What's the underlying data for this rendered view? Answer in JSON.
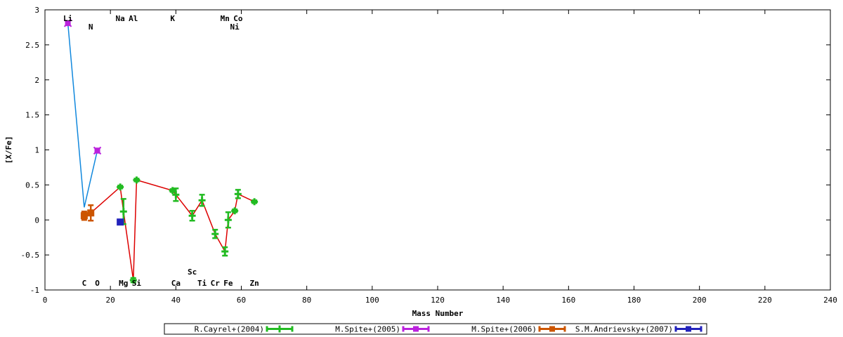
{
  "chart_data": {
    "type": "scatter",
    "xlabel": "Mass Number",
    "ylabel": "[X/Fe]",
    "xlim": [
      0,
      240
    ],
    "ylim": [
      -1,
      3
    ],
    "xticks": [
      0,
      20,
      40,
      60,
      80,
      100,
      120,
      140,
      160,
      180,
      200,
      220,
      240
    ],
    "yticks": [
      -1,
      -0.5,
      0,
      0.5,
      1,
      1.5,
      2,
      2.5,
      3
    ],
    "xtick_labels": [
      "0",
      "20",
      "40",
      "60",
      "80",
      "100",
      "120",
      "140",
      "160",
      "180",
      "200",
      "220",
      "240"
    ],
    "ytick_labels": [
      "-1",
      "-0.5",
      "0",
      "0.5",
      "1",
      "1.5",
      "2",
      "2.5",
      "3"
    ],
    "grid": false,
    "legend_position": "bottom",
    "element_labels": {
      "top_row": [
        {
          "text": "Li",
          "x": 7
        },
        {
          "text": "Na",
          "x": 23
        },
        {
          "text": "Al",
          "x": 27
        },
        {
          "text": "K",
          "x": 39
        },
        {
          "text": "Mn",
          "x": 55
        },
        {
          "text": "Co",
          "x": 59
        }
      ],
      "second_row": [
        {
          "text": "N",
          "x": 14
        },
        {
          "text": "Ni",
          "x": 58
        }
      ],
      "bottom_row": [
        {
          "text": "C",
          "x": 12
        },
        {
          "text": "O",
          "x": 16
        },
        {
          "text": "Mg",
          "x": 24
        },
        {
          "text": "Si",
          "x": 28
        },
        {
          "text": "Ca",
          "x": 40
        },
        {
          "text": "Ti",
          "x": 48
        },
        {
          "text": "Cr",
          "x": 52
        },
        {
          "text": "Fe",
          "x": 56
        },
        {
          "text": "Zn",
          "x": 64
        }
      ],
      "sc_label": {
        "text": "Sc",
        "x": 45
      }
    },
    "series": [
      {
        "name": "R.Cayrel+(2004)",
        "color": "#22bb22",
        "line_color": "#dd0000",
        "marker": "plus",
        "points": [
          {
            "x": 23,
            "y": 0.47,
            "err": 0.02
          },
          {
            "x": 24,
            "y": 0.12,
            "err": 0.18
          },
          {
            "x": 27,
            "y": -0.86,
            "err": 0.03
          },
          {
            "x": 28,
            "y": 0.57,
            "err": 0.02
          },
          {
            "x": 39,
            "y": 0.42,
            "err": 0.02
          },
          {
            "x": 40,
            "y": 0.36,
            "err": 0.09
          },
          {
            "x": 45,
            "y": 0.06,
            "err": 0.07
          },
          {
            "x": 48,
            "y": 0.28,
            "err": 0.08
          },
          {
            "x": 52,
            "y": -0.2,
            "err": 0.06
          },
          {
            "x": 55,
            "y": -0.45,
            "err": 0.06
          },
          {
            "x": 56,
            "y": 0.0,
            "err": 0.11
          },
          {
            "x": 58,
            "y": 0.13,
            "err": 0.02
          },
          {
            "x": 59,
            "y": 0.37,
            "err": 0.06
          },
          {
            "x": 64,
            "y": 0.26,
            "err": 0.02
          }
        ]
      },
      {
        "name": "M.Spite+(2005)",
        "color": "#bb22dd",
        "line_color": "#1188dd",
        "marker": "x-square",
        "points": [
          {
            "x": 7,
            "y": 2.81,
            "err": 0.03
          },
          {
            "x": 12,
            "y": 0.18,
            "err": 0.0
          },
          {
            "x": 16,
            "y": 0.99,
            "err": 0.03
          }
        ]
      },
      {
        "name": "M.Spite+(2006)",
        "color": "#cc5500",
        "line_color": "#cc5500",
        "marker": "square",
        "points": [
          {
            "x": 12,
            "y": 0.06,
            "err": 0.06
          },
          {
            "x": 14,
            "y": 0.1,
            "err": 0.11
          }
        ]
      },
      {
        "name": "S.M.Andrievsky+(2007)",
        "color": "#2222bb",
        "line_color": "#2222bb",
        "marker": "square",
        "points": [
          {
            "x": 23,
            "y": -0.03,
            "err": 0.0
          }
        ]
      }
    ]
  }
}
